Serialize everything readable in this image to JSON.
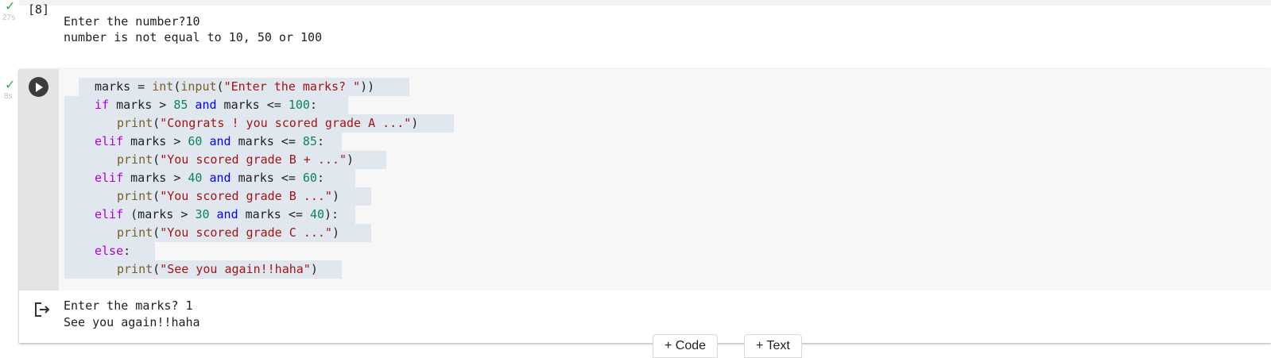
{
  "cell1": {
    "status_check": "✓",
    "exec_time": "27s",
    "exec_count": "[8]",
    "output_lines": [
      "Enter the number?10",
      "number is not equal to 10, 50 or 100"
    ]
  },
  "cell2": {
    "status_check": "✓",
    "exec_time": "8s",
    "code": {
      "l1": {
        "a": "marks = ",
        "b": "int",
        "c": "(",
        "d": "input",
        "e": "(",
        "f": "\"Enter the marks? \"",
        "g": "))"
      },
      "l2": {
        "a": "if",
        "b": " marks > ",
        "c": "85",
        "d": " and",
        "e": " marks <= ",
        "f": "100",
        "g": ":"
      },
      "l3": {
        "a": "print",
        "b": "(",
        "c": "\"Congrats ! you scored grade A ...\"",
        "d": ")"
      },
      "l4": {
        "a": "elif",
        "b": " marks > ",
        "c": "60",
        "d": " and",
        "e": " marks <= ",
        "f": "85",
        "g": ":"
      },
      "l5": {
        "a": "print",
        "b": "(",
        "c": "\"You scored grade B + ...\"",
        "d": ")"
      },
      "l6": {
        "a": "elif",
        "b": " marks > ",
        "c": "40",
        "d": " and",
        "e": " marks <= ",
        "f": "60",
        "g": ":"
      },
      "l7": {
        "a": "print",
        "b": "(",
        "c": "\"You scored grade B ...\"",
        "d": ")"
      },
      "l8": {
        "a": "elif",
        "b": " (marks > ",
        "c": "30",
        "d": " and",
        "e": " marks <= ",
        "f": "40",
        "g": "):"
      },
      "l9": {
        "a": "print",
        "b": "(",
        "c": "\"You scored grade C ...\"",
        "d": ")"
      },
      "l10": {
        "a": "else",
        "b": ":"
      },
      "l11": {
        "a": "print",
        "b": "(",
        "c": "\"See you again!!haha\"",
        "d": ")"
      }
    },
    "output_lines": [
      "Enter the marks? 1",
      "See you again!!haha"
    ]
  },
  "toolbar": {
    "add_code_label": "+ Code",
    "add_text_label": "+ Text"
  },
  "colors": {
    "keyword": "#af00db",
    "operator": "#0000ff",
    "number": "#098658",
    "string": "#a31515",
    "function": "#795e26",
    "success": "#34a853"
  }
}
